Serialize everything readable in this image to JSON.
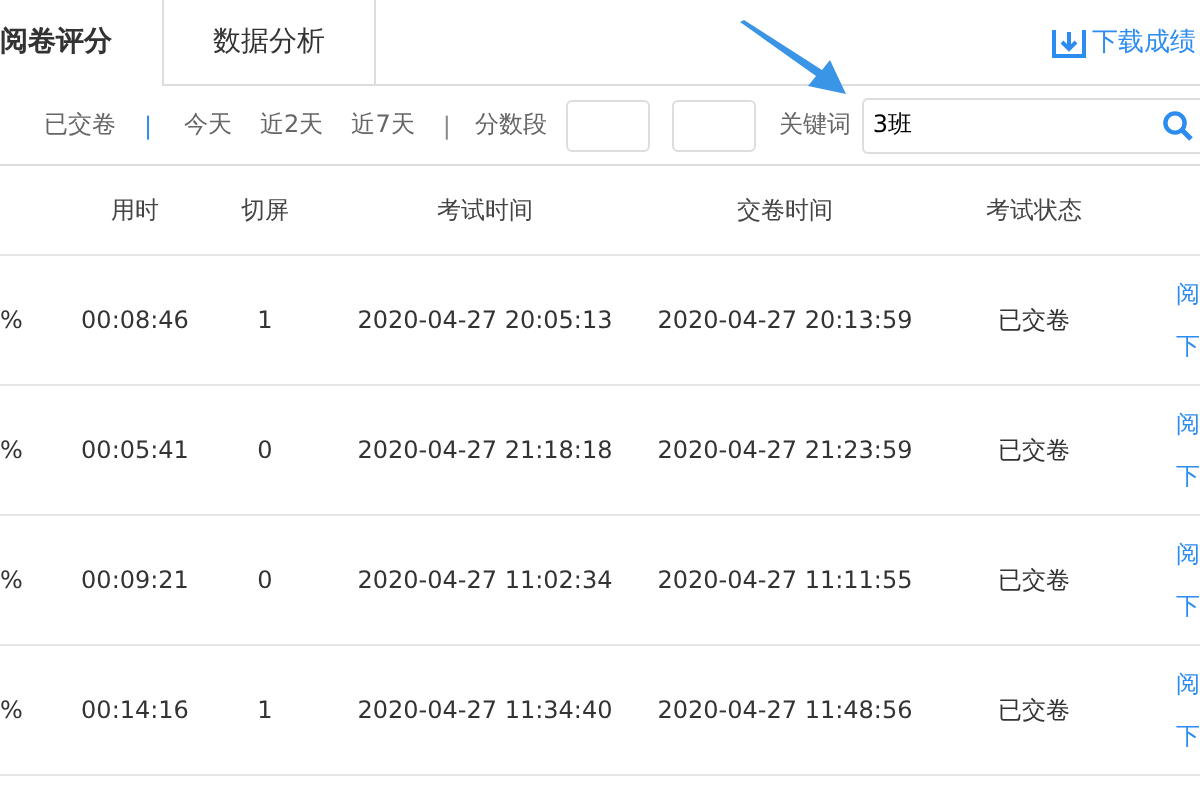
{
  "tabs": [
    {
      "label": "阅卷评分",
      "selected": true
    },
    {
      "label": "数据分析",
      "selected": false
    }
  ],
  "download_link": "下载成绩",
  "filters": [
    {
      "label": "已交卷",
      "kind": "option"
    },
    {
      "label": "|",
      "kind": "separator"
    },
    {
      "label": "今天",
      "kind": "option"
    },
    {
      "label": "近2天",
      "kind": "option"
    },
    {
      "label": "近7天",
      "kind": "option"
    },
    {
      "label": "|",
      "kind": "separator"
    },
    {
      "label": "分数段",
      "kind": "label"
    }
  ],
  "keyword": {
    "label": "关键词",
    "value": "3班"
  },
  "table": {
    "columns": [
      "",
      "用时",
      "切屏",
      "考试时间",
      "交卷时间",
      "考试状态"
    ],
    "rows": [
      {
        "cells": [
          "%",
          "00:08:46",
          "1",
          "2020-04-27 20:05:13",
          "2020-04-27 20:13:59",
          "已交卷"
        ],
        "actions": [
          "阅",
          "下"
        ]
      },
      {
        "cells": [
          "%",
          "00:05:41",
          "0",
          "2020-04-27 21:18:18",
          "2020-04-27 21:23:59",
          "已交卷"
        ],
        "actions": [
          "阅",
          "下"
        ]
      },
      {
        "cells": [
          "%",
          "00:09:21",
          "0",
          "2020-04-27 11:02:34",
          "2020-04-27 11:11:55",
          "已交卷"
        ],
        "actions": [
          "阅",
          "下"
        ]
      },
      {
        "cells": [
          "%",
          "00:14:16",
          "1",
          "2020-04-27 11:34:40",
          "2020-04-27 11:48:56",
          "已交卷"
        ],
        "actions": [
          "阅",
          "下"
        ]
      }
    ]
  }
}
